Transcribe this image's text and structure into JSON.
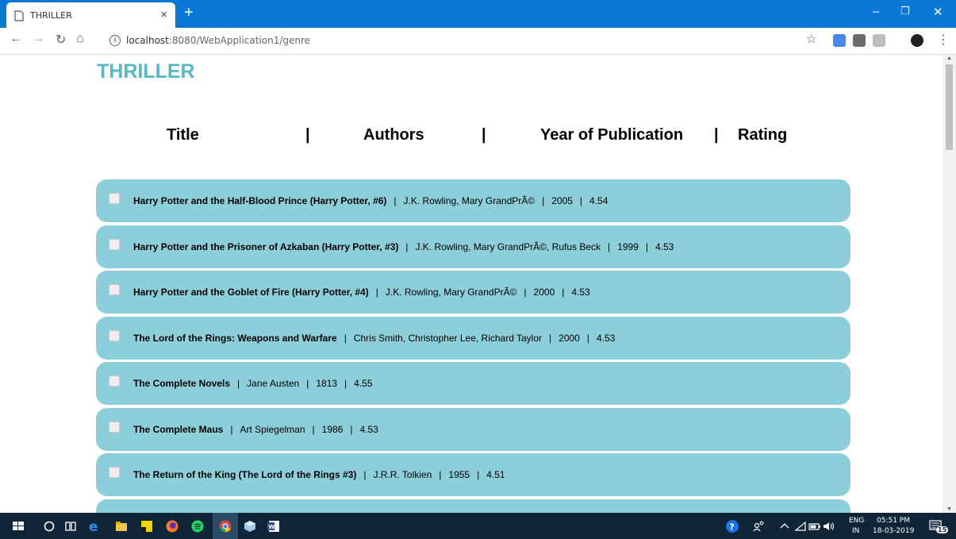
{
  "browser": {
    "tab_title": "THRILLER",
    "tab_close": "×",
    "new_tab": "+",
    "url_host": "localhost",
    "url_rest": ":8080/WebApplication1/genre",
    "window_controls": [
      "–",
      "❐",
      "✕"
    ]
  },
  "page": {
    "title": "THRILLER",
    "headers": {
      "title": "Title",
      "sep1": "|",
      "authors": "Authors",
      "sep2": "|",
      "year": "Year of Publication",
      "sep3": "|",
      "rating": "Rating"
    },
    "separator": "|",
    "books": [
      {
        "title": "Harry Potter and the Half-Blood Prince (Harry Potter, #6)",
        "authors": "J.K. Rowling, Mary GrandPrÃ©",
        "year": "2005",
        "rating": "4.54"
      },
      {
        "title": "Harry Potter and the Prisoner of Azkaban (Harry Potter, #3)",
        "authors": "J.K. Rowling, Mary GrandPrÃ©, Rufus Beck",
        "year": "1999",
        "rating": "4.53"
      },
      {
        "title": "Harry Potter and the Goblet of Fire (Harry Potter, #4)",
        "authors": "J.K. Rowling, Mary GrandPrÃ©",
        "year": "2000",
        "rating": "4.53"
      },
      {
        "title": "The Lord of the Rings: Weapons and Warfare",
        "authors": "Chris Smith, Christopher Lee, Richard Taylor",
        "year": "2000",
        "rating": "4.53"
      },
      {
        "title": "The Complete Novels",
        "authors": "Jane Austen",
        "year": "1813",
        "rating": "4.55"
      },
      {
        "title": "The Complete Maus",
        "authors": "Art Spiegelman",
        "year": "1986",
        "rating": "4.53"
      },
      {
        "title": "The Return of the King (The Lord of the Rings #3)",
        "authors": "J.R.R. Tolkien",
        "year": "1955",
        "rating": "4.51"
      }
    ]
  },
  "taskbar": {
    "lang_1": "ENG",
    "lang_2": "IN",
    "time": "05:51 PM",
    "date": "18-03-2019",
    "notification_count": "15"
  },
  "colors": {
    "title_bar": "#0a78d7",
    "page_title": "#55b8c8",
    "row_bg": "#8cceda",
    "taskbar": "#102638"
  }
}
